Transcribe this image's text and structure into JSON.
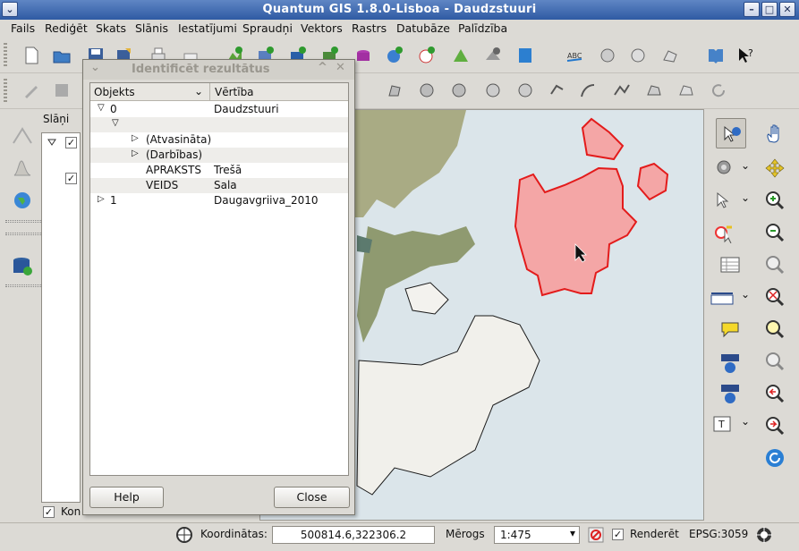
{
  "window": {
    "title": "Quantum GIS 1.8.0-Lisboa - Daudzstuuri"
  },
  "menu": [
    "Fails",
    "Rediģēt",
    "Skats",
    "Slānis",
    "Iestatījumi",
    "Spraudņi",
    "Vektors",
    "Rastrs",
    "Datubāze",
    "Palīdzība"
  ],
  "layers_panel": {
    "title": "Slāņi",
    "bottom_checkbox_label": "Kon"
  },
  "dialog": {
    "title": "Identificēt rezultātus",
    "col_object": "Objekts",
    "col_value": "Vērtība",
    "rows": [
      {
        "object": "0",
        "value": "Daudzstuuri"
      },
      {
        "object": "",
        "value": ""
      },
      {
        "object": "(Atvasināta)",
        "value": ""
      },
      {
        "object": "(Darbības)",
        "value": ""
      },
      {
        "object": "APRAKSTS",
        "value": "Trešā"
      },
      {
        "object": "VEIDS",
        "value": "Sala"
      },
      {
        "object": "1",
        "value": "Daugavgriiva_2010"
      }
    ],
    "help_label": "Help",
    "close_label": "Close"
  },
  "status": {
    "coords_label": "Koordinātas:",
    "coords_value": "500814.6,322306.2",
    "scale_label": "Mērogs",
    "scale_value": "1:475",
    "render_label": "Renderēt",
    "epsg": "EPSG:3059"
  },
  "colors": {
    "title_bar": "#3b65ab",
    "selected_polygon": "#f4a6a6",
    "selected_outline": "#e31b1b"
  }
}
